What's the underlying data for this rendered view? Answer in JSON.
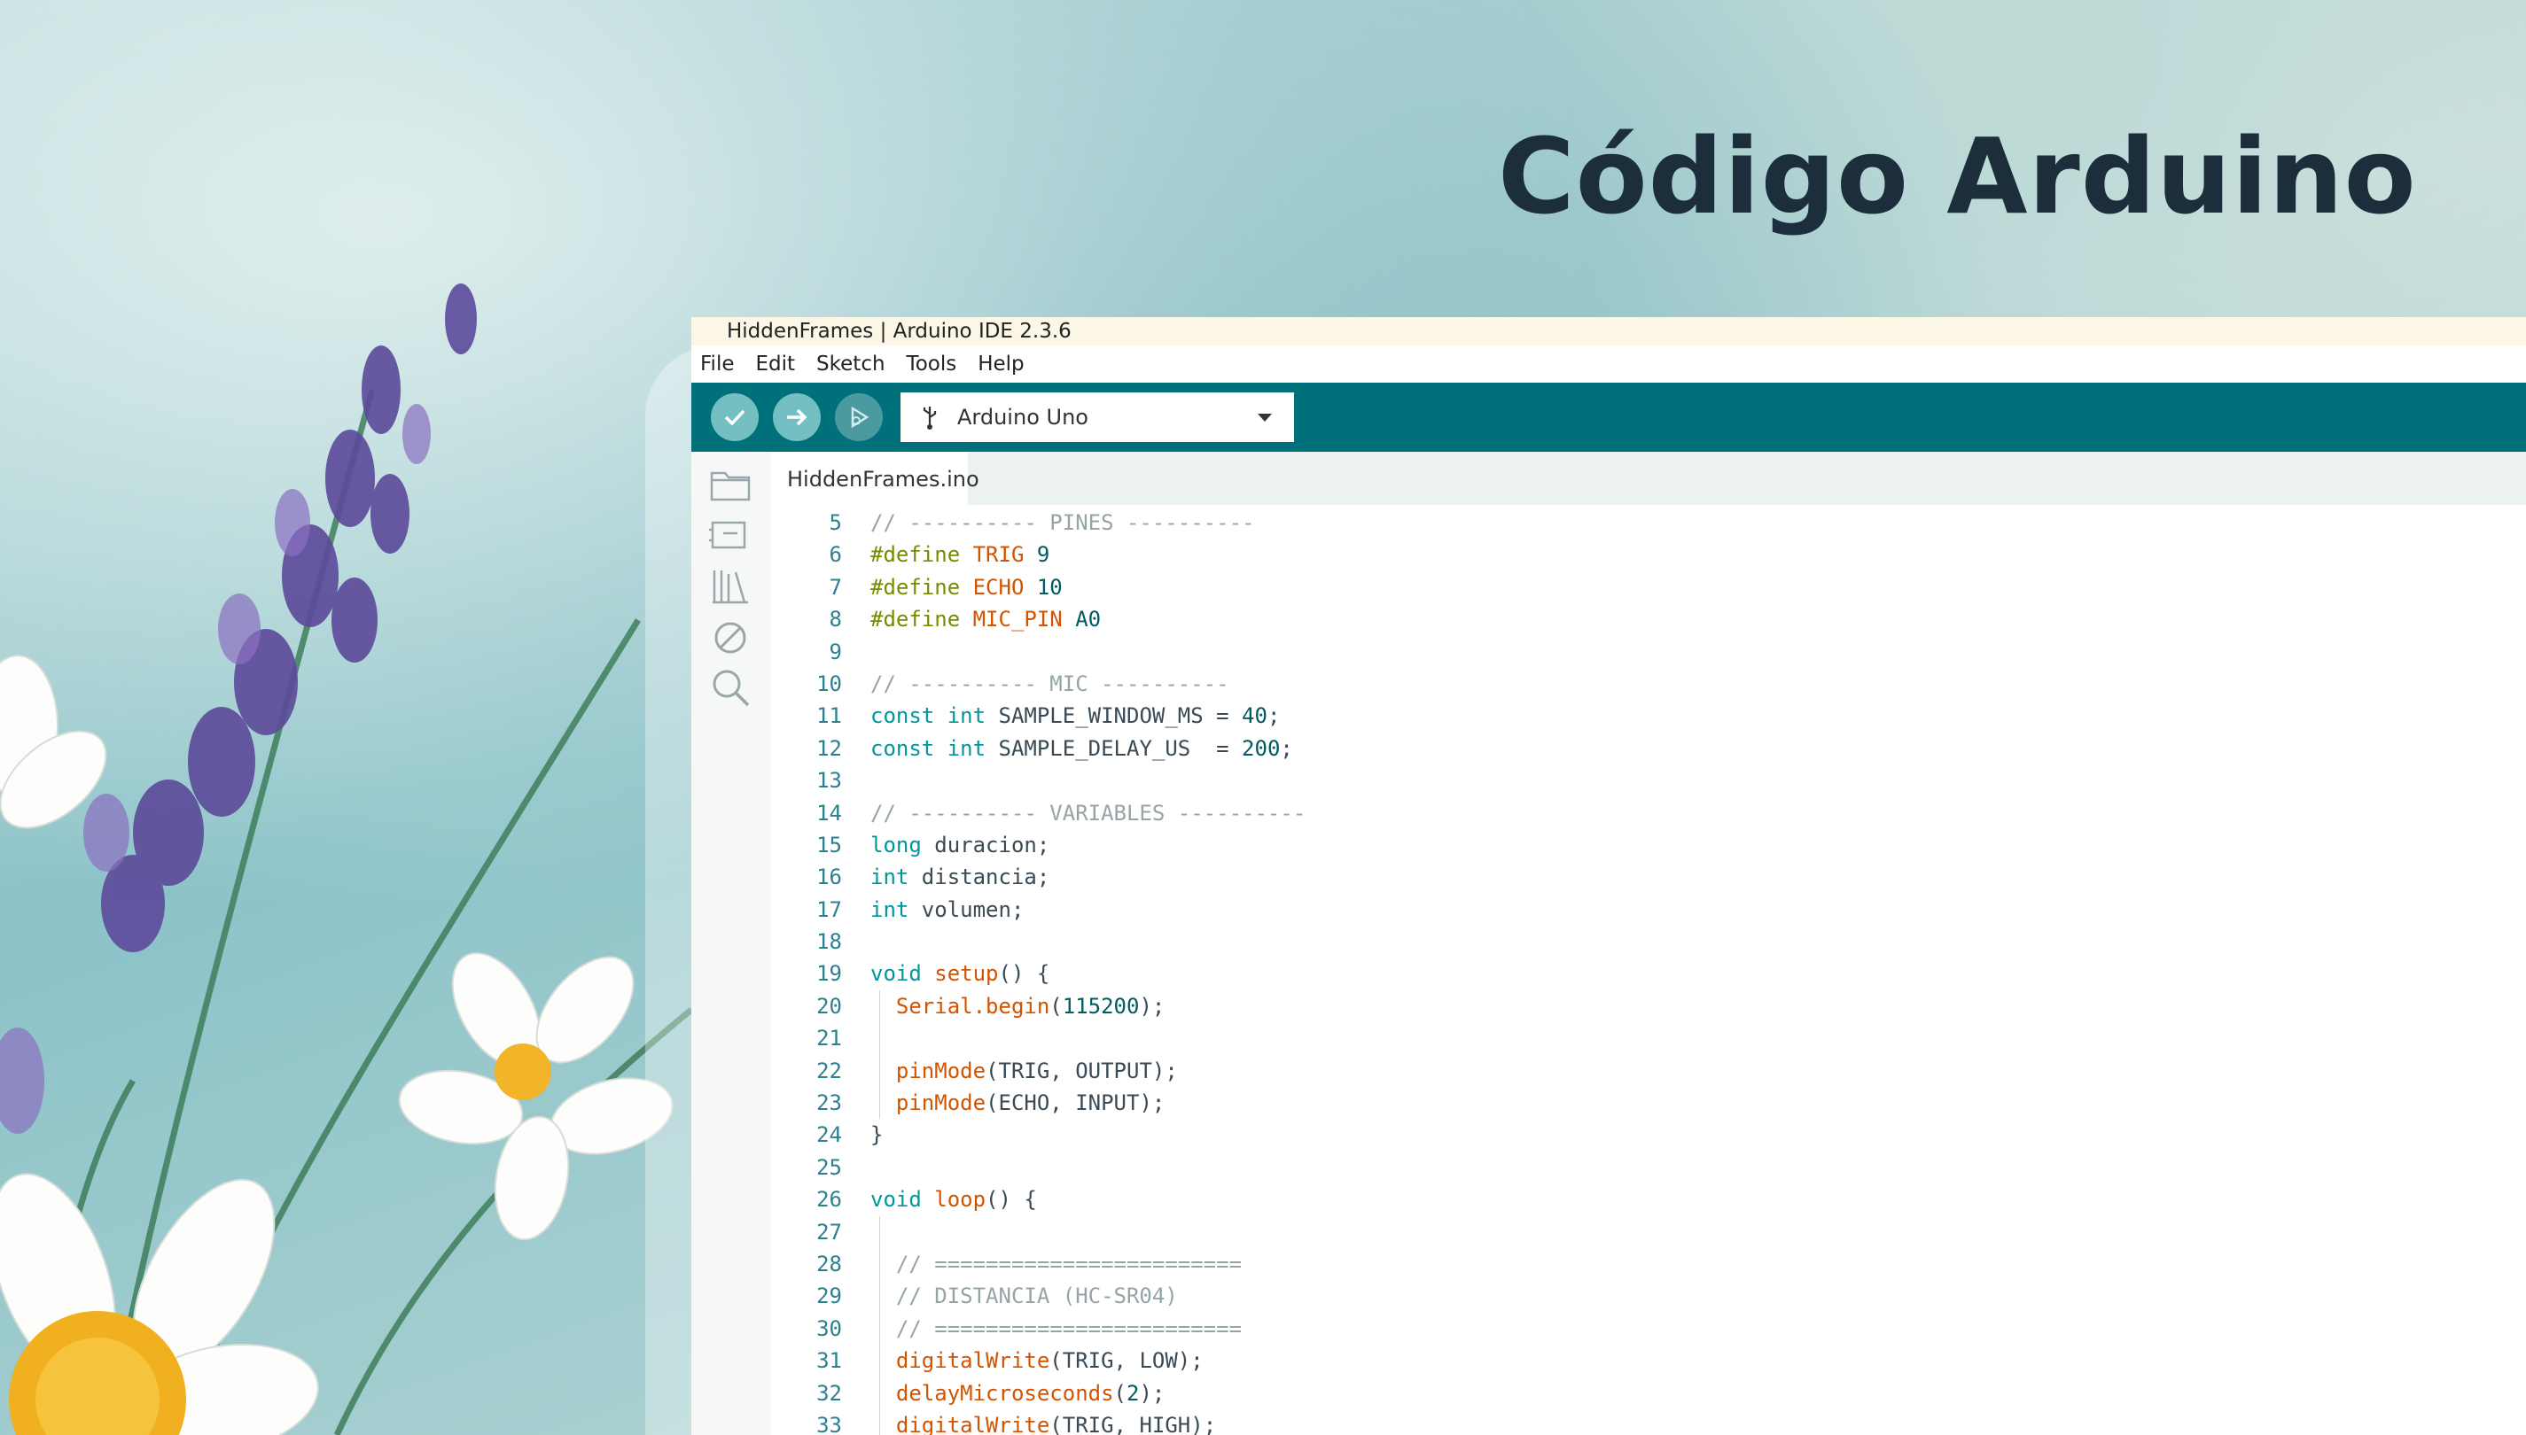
{
  "slide": {
    "title": "Código Arduino"
  },
  "window": {
    "title": "HiddenFrames | Arduino IDE 2.3.6"
  },
  "menu": [
    "File",
    "Edit",
    "Sketch",
    "Tools",
    "Help"
  ],
  "toolbar": {
    "board": "Arduino Uno",
    "buttons": [
      "verify-icon",
      "upload-icon",
      "debug-icon"
    ]
  },
  "sidebar_icons": [
    "folder-icon",
    "board-manager-icon",
    "library-icon",
    "no-debug-icon",
    "search-icon"
  ],
  "tab": {
    "filename": "HiddenFrames.ino"
  },
  "code": {
    "line_numbers": [
      "5",
      "6",
      "7",
      "8",
      "9",
      "10",
      "11",
      "12",
      "13",
      "14",
      "15",
      "16",
      "17",
      "18",
      "19",
      "20",
      "21",
      "22",
      "23",
      "24",
      "25",
      "26",
      "27",
      "28",
      "29",
      "30",
      "31",
      "32",
      "33"
    ],
    "lines": [
      "// ---------- PINES ----------",
      "#define TRIG 9",
      "#define ECHO 10",
      "#define MIC_PIN A0",
      "",
      "// ---------- MIC ----------",
      "const int SAMPLE_WINDOW_MS = 40;",
      "const int SAMPLE_DELAY_US  = 200;",
      "",
      "// ---------- VARIABLES ----------",
      "long duracion;",
      "int distancia;",
      "int volumen;",
      "",
      "void setup() {",
      "  Serial.begin(115200);",
      "",
      "  pinMode(TRIG, OUTPUT);",
      "  pinMode(ECHO, INPUT);",
      "}",
      "",
      "void loop() {",
      "",
      "  // ========================",
      "  // DISTANCIA (HC-SR04)",
      "  // ========================",
      "  digitalWrite(TRIG, LOW);",
      "  delayMicroseconds(2);",
      "  digitalWrite(TRIG, HIGH);"
    ]
  }
}
